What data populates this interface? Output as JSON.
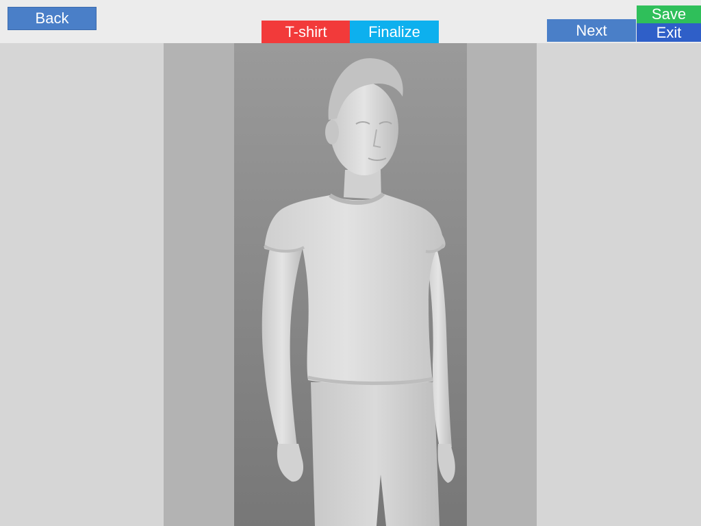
{
  "toolbar": {
    "back_label": "Back",
    "next_label": "Next",
    "save_label": "Save",
    "exit_label": "Exit"
  },
  "tabs": [
    {
      "label": "T-shirt",
      "active": true
    },
    {
      "label": "Finalize",
      "active": false
    }
  ],
  "colors": {
    "back": "#4a7fc8",
    "next": "#4a7fc8",
    "tab_tshirt": "#f23a3a",
    "tab_finalize": "#0db0ee",
    "save": "#2fbf5a",
    "exit": "#2f5fc8"
  },
  "viewport": {
    "content": "3d-avatar-model"
  }
}
